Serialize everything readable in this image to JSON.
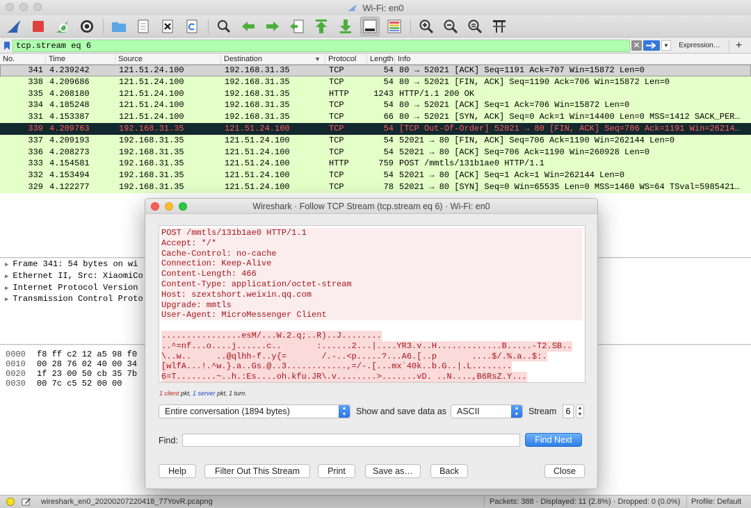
{
  "window": {
    "title": "Wi-Fi: en0"
  },
  "toolbar": {
    "icons": [
      "shark-fin-start-icon",
      "stop-icon",
      "restart-icon",
      "gear-options-icon",
      "folder-open-icon",
      "file-icon",
      "close-file-icon",
      "reload-icon",
      "search-icon",
      "arrow-back-icon",
      "arrow-forward-icon",
      "go-to-packet-icon",
      "first-packet-icon",
      "last-packet-icon",
      "autoscroll-icon",
      "colorize-icon",
      "zoom-in-icon",
      "zoom-out-icon",
      "zoom-normal-icon",
      "resize-columns-icon"
    ]
  },
  "filter": {
    "value": "tcp.stream eq 6",
    "clear_label": "✕",
    "expression_label": "Expression…",
    "add_label": "+"
  },
  "packet_list": {
    "columns": [
      "No.",
      "Time",
      "Source",
      "Destination",
      "Protocol",
      "Length",
      "Info"
    ],
    "rows": [
      {
        "no": "341",
        "time": "4.239242",
        "src": "121.51.24.100",
        "dst": "192.168.31.35",
        "proto": "TCP",
        "len": "54",
        "info": "80 → 52021 [ACK] Seq=1191 Ack=707 Win=15872 Len=0",
        "style": "gray"
      },
      {
        "no": "338",
        "time": "4.209686",
        "src": "121.51.24.100",
        "dst": "192.168.31.35",
        "proto": "TCP",
        "len": "54",
        "info": "80 → 52021 [FIN, ACK] Seq=1190 Ack=706 Win=15872 Len=0",
        "style": "green"
      },
      {
        "no": "335",
        "time": "4.208180",
        "src": "121.51.24.100",
        "dst": "192.168.31.35",
        "proto": "HTTP",
        "len": "1243",
        "info": "HTTP/1.1 200 OK",
        "style": "green"
      },
      {
        "no": "334",
        "time": "4.185248",
        "src": "121.51.24.100",
        "dst": "192.168.31.35",
        "proto": "TCP",
        "len": "54",
        "info": "80 → 52021 [ACK] Seq=1 Ack=706 Win=15872 Len=0",
        "style": "green"
      },
      {
        "no": "331",
        "time": "4.153387",
        "src": "121.51.24.100",
        "dst": "192.168.31.35",
        "proto": "TCP",
        "len": "66",
        "info": "80 → 52021 [SYN, ACK] Seq=0 Ack=1 Win=14400 Len=0 MSS=1412 SACK_PER…",
        "style": "green"
      },
      {
        "no": "339",
        "time": "4.209763",
        "src": "192.168.31.35",
        "dst": "121.51.24.100",
        "proto": "TCP",
        "len": "54",
        "info": "[TCP Out-Of-Order] 52021 → 80 [FIN, ACK] Seq=706 Ack=1191 Win=26214…",
        "style": "dark"
      },
      {
        "no": "337",
        "time": "4.209193",
        "src": "192.168.31.35",
        "dst": "121.51.24.100",
        "proto": "TCP",
        "len": "54",
        "info": "52021 → 80 [FIN, ACK] Seq=706 Ack=1190 Win=262144 Len=0",
        "style": "green"
      },
      {
        "no": "336",
        "time": "4.208273",
        "src": "192.168.31.35",
        "dst": "121.51.24.100",
        "proto": "TCP",
        "len": "54",
        "info": "52021 → 80 [ACK] Seq=706 Ack=1190 Win=260928 Len=0",
        "style": "green"
      },
      {
        "no": "333",
        "time": "4.154581",
        "src": "192.168.31.35",
        "dst": "121.51.24.100",
        "proto": "HTTP",
        "len": "759",
        "info": "POST /mmtls/131b1ae0 HTTP/1.1",
        "style": "green"
      },
      {
        "no": "332",
        "time": "4.153494",
        "src": "192.168.31.35",
        "dst": "121.51.24.100",
        "proto": "TCP",
        "len": "54",
        "info": "52021 → 80 [ACK] Seq=1 Ack=1 Win=262144 Len=0",
        "style": "green"
      },
      {
        "no": "329",
        "time": "4.122277",
        "src": "192.168.31.35",
        "dst": "121.51.24.100",
        "proto": "TCP",
        "len": "78",
        "info": "52021 → 80 [SYN] Seq=0 Win=65535 Len=0 MSS=1460 WS=64 TSval=5985421…",
        "style": "green"
      }
    ]
  },
  "details": {
    "items": [
      "Frame 341: 54 bytes on wi",
      "Ethernet II, Src: XiaomiCo",
      "Internet Protocol Version",
      "Transmission Control Proto"
    ]
  },
  "bytes": {
    "rows": [
      {
        "offset": "0000",
        "hex": "f8 ff c2 12 a5 98 f0"
      },
      {
        "offset": "0010",
        "hex": "00 28 76 02 40 00 34"
      },
      {
        "offset": "0020",
        "hex": "1f 23 00 50 cb 35 7b"
      },
      {
        "offset": "0030",
        "hex": "00 7c c5 52 00 00"
      }
    ]
  },
  "status": {
    "file": "wireshark_en0_20200207220418_77YovR.pcapng",
    "packets": "Packets: 388 · Displayed: 11 (2.8%) · Dropped: 0 (0.0%)",
    "profile": "Profile: Default"
  },
  "dialog": {
    "title": "Wireshark · Follow TCP Stream (tcp.stream eq 6) · Wi-Fi: en0",
    "stream_lines": [
      "POST /mmtls/131b1ae0 HTTP/1.1",
      "Accept: */*",
      "Cache-Control: no-cache",
      "Connection: Keep-Alive",
      "Content-Length: 466",
      "Content-Type: application/octet-stream",
      "Host: szextshort.weixin.qq.com",
      "Upgrade: mmtls",
      "User-Agent: MicroMessenger Client"
    ],
    "binary_lines": [
      "................esM/...W.2.q;..R)..J........",
      "..^=nf...o....j......c..       :......2...|....YR3.v..H.............B.....-T2.SB..",
      "\\..w..     ..@qlhh-f..y{=       /.-..<p.....?...A6.[..p       ....$/.%.a..$:.",
      "[wlfA...!.^w.}.a..Gs.@..3............,=/-.[...mx`40k..b.G..|.L........",
      "6=T........~..h.:Es....oh.kfu.JR\\.v........>.......vD. ..N....,B6RsZ.Y..."
    ],
    "summary": {
      "client": "1 client",
      "mid1": " pkt, ",
      "server": "1 server",
      "mid2": " pkt, 1 turn."
    },
    "conversation_select": "Entire conversation (1894 bytes)",
    "show_label": "Show and save data as",
    "format_select": "ASCII",
    "stream_label": "Stream",
    "stream_number": "6",
    "find_label": "Find:",
    "find_value": "",
    "find_next_label": "Find Next",
    "buttons": {
      "help": "Help",
      "filter_out": "Filter Out This Stream",
      "print": "Print",
      "save_as": "Save as…",
      "back": "Back",
      "close": "Close"
    }
  }
}
